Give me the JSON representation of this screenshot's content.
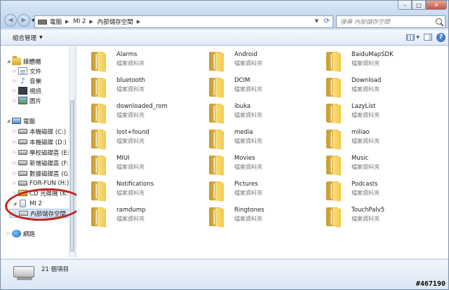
{
  "window": {
    "controls": {
      "minimize": "–",
      "maximize": "□",
      "close": "✕"
    }
  },
  "navigation": {
    "back": "◀",
    "forward": "▶"
  },
  "address": {
    "crumbs": [
      {
        "label": "電腦"
      },
      {
        "label": "MI 2"
      },
      {
        "label": "內部儲存空間"
      }
    ],
    "refresh": "⟳"
  },
  "search": {
    "placeholder": "搜尋 內部儲存空間"
  },
  "toolbar": {
    "organize": "組合管理",
    "help": "?"
  },
  "nav": {
    "favorites": {
      "label": "媒體櫃"
    },
    "libraries": [
      {
        "label": "文件",
        "icon": "document-icon"
      },
      {
        "label": "音樂",
        "icon": "music-icon"
      },
      {
        "label": "視訊",
        "icon": "video-icon"
      },
      {
        "label": "圖片",
        "icon": "picture-icon"
      }
    ],
    "computer": {
      "label": "電腦"
    },
    "drives": [
      {
        "label": "本機磁碟 (C:)"
      },
      {
        "label": "本機磁碟 (D:)"
      },
      {
        "label": "學校磁碟區 (E:)"
      },
      {
        "label": "新增磁碟區 (F:)"
      },
      {
        "label": "數據磁碟區 (G:)"
      },
      {
        "label": "FOR-FUN (H:)"
      },
      {
        "label": "CD 光碟機 (K:) X"
      }
    ],
    "device": {
      "label": "MI 2"
    },
    "device_child": {
      "label": "內部儲存空間"
    },
    "network": {
      "label": "網路"
    }
  },
  "folders": [
    {
      "name": "Alarms",
      "type": "檔案資料夾"
    },
    {
      "name": "Android",
      "type": "檔案資料夾"
    },
    {
      "name": "BaiduMapSDK",
      "type": "檔案資料夾"
    },
    {
      "name": "bluetooth",
      "type": "檔案資料夾"
    },
    {
      "name": "DCIM",
      "type": "檔案資料夾"
    },
    {
      "name": "Download",
      "type": "檔案資料夾"
    },
    {
      "name": "downloaded_rom",
      "type": "檔案資料夾"
    },
    {
      "name": "ibuka",
      "type": "檔案資料夾"
    },
    {
      "name": "LazyList",
      "type": "檔案資料夾"
    },
    {
      "name": "lost+found",
      "type": "檔案資料夾"
    },
    {
      "name": "media",
      "type": "檔案資料夾"
    },
    {
      "name": "miliao",
      "type": "檔案資料夾"
    },
    {
      "name": "MIUI",
      "type": "檔案資料夾"
    },
    {
      "name": "Movies",
      "type": "檔案資料夾"
    },
    {
      "name": "Music",
      "type": "檔案資料夾"
    },
    {
      "name": "Notifications",
      "type": "檔案資料夾"
    },
    {
      "name": "Pictures",
      "type": "檔案資料夾"
    },
    {
      "name": "Podcasts",
      "type": "檔案資料夾"
    },
    {
      "name": "ramdump",
      "type": "檔案資料夾"
    },
    {
      "name": "Ringtones",
      "type": "檔案資料夾"
    },
    {
      "name": "TouchPalv5",
      "type": "檔案資料夾"
    }
  ],
  "status": {
    "item_count": "21 個項目"
  },
  "watermark": "#467190",
  "colors": {
    "annotation_ring": "#c1261b",
    "folder": "#f1c94e",
    "selection": "#dbe9f9"
  }
}
